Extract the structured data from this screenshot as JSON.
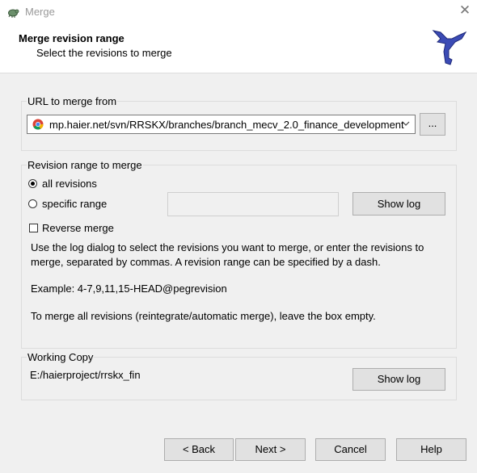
{
  "window": {
    "title": "Merge",
    "close_glyph": "✕"
  },
  "header": {
    "title": "Merge revision range",
    "subtitle": "Select the revisions to merge"
  },
  "url_group": {
    "legend": "URL to merge from",
    "url_value": "mp.haier.net/svn/RRSKX/branches/branch_mecv_2.0_finance_development",
    "browse_label": "..."
  },
  "range_group": {
    "legend": "Revision range to merge",
    "all_revisions_label": "all revisions",
    "all_revisions_selected": true,
    "specific_range_label": "specific range",
    "range_value": "",
    "show_log_label": "Show log",
    "reverse_merge_label": "Reverse merge",
    "reverse_merge_checked": false,
    "help_line1": "Use the log dialog to select the revisions you want to merge, or enter the revisions to",
    "help_line2": "merge, separated by commas. A revision range can be specified by a dash.",
    "example": "Example: 4-7,9,11,15-HEAD@pegrevision",
    "note": "To merge all revisions (reintegrate/automatic merge), leave the box empty."
  },
  "working_copy": {
    "legend": "Working Copy",
    "path": "E:/haierproject/rrskx_fin",
    "show_log_label": "Show log"
  },
  "footer": {
    "back_label": "< Back",
    "next_label": "Next >",
    "cancel_label": "Cancel",
    "help_label": "Help"
  },
  "colors": {
    "dialog_bg": "#f0f0f0",
    "header_bg": "#ffffff",
    "button_bg": "#e1e1e1",
    "button_border": "#adadad",
    "wizard_icon": "#3b4bb5"
  },
  "icons": [
    "tortoise-app-icon",
    "close-icon",
    "tortoisesvn-wizard-icon",
    "chrome-icon",
    "chevron-down-icon"
  ]
}
